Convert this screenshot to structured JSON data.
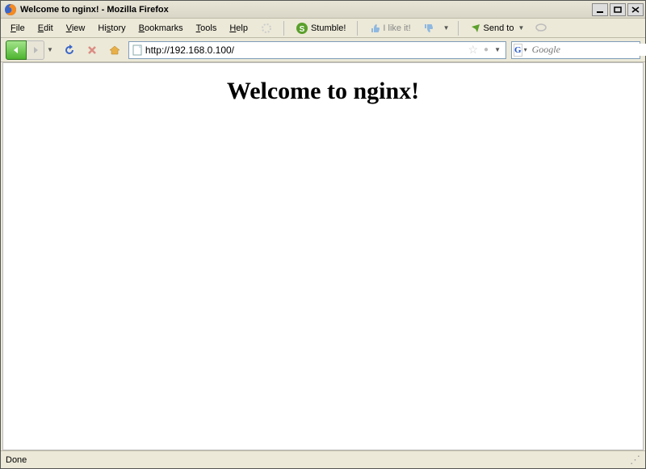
{
  "window": {
    "title": "Welcome to nginx! - Mozilla Firefox"
  },
  "menus": {
    "file": "File",
    "edit": "Edit",
    "view": "View",
    "history": "History",
    "bookmarks": "Bookmarks",
    "tools": "Tools",
    "help": "Help"
  },
  "stumble": {
    "label": "Stumble!",
    "like": "I like it!",
    "sendto": "Send to"
  },
  "nav": {
    "url": "http://192.168.0.100/",
    "search_placeholder": "Google"
  },
  "page": {
    "heading": "Welcome to nginx!"
  },
  "status": {
    "text": "Done"
  }
}
